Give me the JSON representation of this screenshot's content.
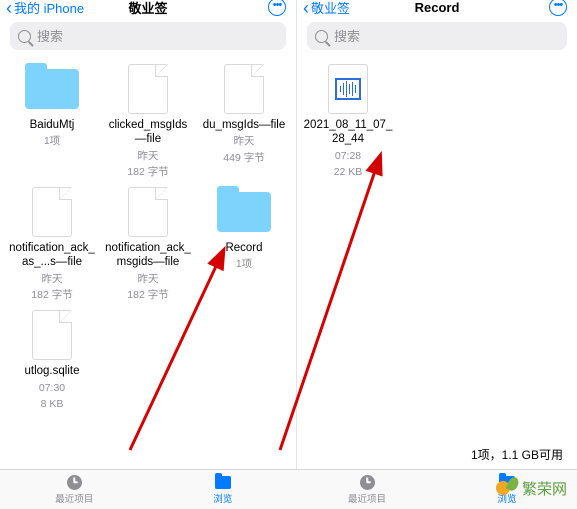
{
  "left": {
    "back_label": "我的 iPhone",
    "title": "敬业签",
    "search_placeholder": "搜索",
    "items": [
      {
        "name": "BaiduMtj",
        "meta1": "1项",
        "meta2": "",
        "type": "folder"
      },
      {
        "name": "clicked_msgIds—file",
        "meta1": "昨天",
        "meta2": "182 字节",
        "type": "file"
      },
      {
        "name": "du_msgIds—file",
        "meta1": "昨天",
        "meta2": "449 字节",
        "type": "file"
      },
      {
        "name": "notification_ack_as_...s—file",
        "meta1": "昨天",
        "meta2": "182 字节",
        "type": "file"
      },
      {
        "name": "notification_ack_msgids—file",
        "meta1": "昨天",
        "meta2": "182 字节",
        "type": "file"
      },
      {
        "name": "Record",
        "meta1": "1项",
        "meta2": "",
        "type": "folder"
      },
      {
        "name": "utlog.sqlite",
        "meta1": "07:30",
        "meta2": "8 KB",
        "type": "file"
      }
    ],
    "tabs": {
      "recent": "最近项目",
      "browse": "浏览"
    }
  },
  "right": {
    "back_label": "敬业签",
    "title": "Record",
    "search_placeholder": "搜索",
    "items": [
      {
        "name": "2021_08_11_07_28_44",
        "meta1": "07:28",
        "meta2": "22 KB",
        "type": "audio"
      }
    ],
    "status": "1项，1.1 GB可用",
    "tabs": {
      "recent": "最近项目",
      "browse": "浏览"
    }
  },
  "watermark": "繁荣网"
}
